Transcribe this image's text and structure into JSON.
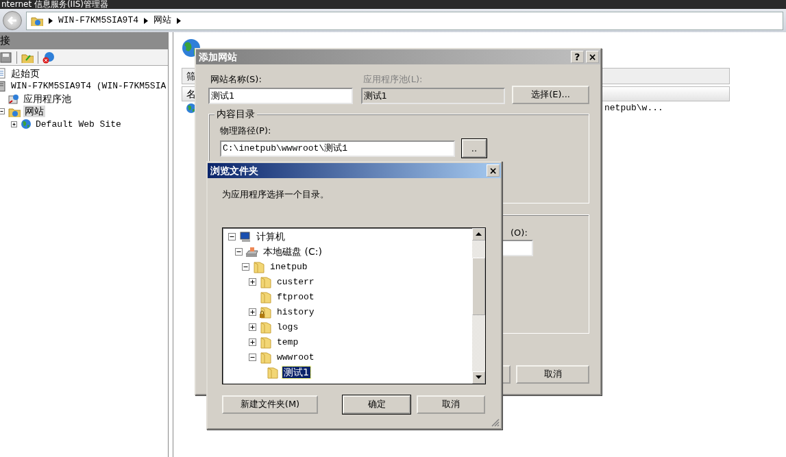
{
  "window": {
    "title": "nternet 信息服务(IIS)管理器"
  },
  "address_bar": {
    "crumbs": [
      "WIN-F7KM5SIA9T4",
      "网站"
    ]
  },
  "connections": {
    "title": "接",
    "tree": [
      {
        "label": "起始页",
        "kind": "page",
        "selected": false
      },
      {
        "label": "WIN-F7KM5SIA9T4 (WIN-F7KM5SIA",
        "kind": "server",
        "selected": false,
        "children": [
          {
            "label": "应用程序池",
            "kind": "pool",
            "selected": false
          },
          {
            "label": "网站",
            "kind": "sites",
            "selected": true,
            "expanded": true,
            "children": [
              {
                "label": "Default Web Site",
                "kind": "globe",
                "selected": false,
                "expanded": false
              }
            ]
          }
        ]
      }
    ]
  },
  "content": {
    "filter_label": "筛",
    "column_1": "名",
    "row_text": "netpub\\w..."
  },
  "add_site_dialog": {
    "title": "添加网站",
    "help_button": "?",
    "close_button": "×",
    "site_name": {
      "label": "网站名称(S):",
      "value": "测试1",
      "disabled": false
    },
    "app_pool": {
      "label": "应用程序池(L):",
      "value": "测试1",
      "disabled": true
    },
    "select_button": "选择(E)...",
    "content_dir_legend": "内容目录",
    "physical_path_label": "物理路径(P):",
    "physical_path": "C:\\inetpub\\wwwroot\\测试1",
    "browse_button": "..",
    "port_label": "(O):",
    "cancel_button": "取消"
  },
  "browse_dialog": {
    "title": "浏览文件夹",
    "close_button": "×",
    "prompt": "为应用程序选择一个目录。",
    "tree": [
      {
        "label": "计算机",
        "kind": "computer",
        "selected": false,
        "expanded": true,
        "children": [
          {
            "label": "本地磁盘 (C:)",
            "kind": "drive",
            "selected": false,
            "expanded": true,
            "children": [
              {
                "label": "inetpub",
                "kind": "folder",
                "locked": false,
                "selected": false,
                "expanded": true,
                "children": [
                  {
                    "label": "custerr",
                    "kind": "folder",
                    "locked": false,
                    "selected": false,
                    "expanded": false
                  },
                  {
                    "label": "ftproot",
                    "kind": "folder",
                    "locked": false,
                    "selected": false
                  },
                  {
                    "label": "history",
                    "kind": "folder",
                    "locked": true,
                    "selected": false,
                    "expanded": false
                  },
                  {
                    "label": "logs",
                    "kind": "folder",
                    "locked": false,
                    "selected": false,
                    "expanded": false
                  },
                  {
                    "label": "temp",
                    "kind": "folder",
                    "locked": false,
                    "selected": false,
                    "expanded": false
                  },
                  {
                    "label": "wwwroot",
                    "kind": "folder",
                    "locked": false,
                    "selected": false,
                    "expanded": true,
                    "children": [
                      {
                        "label": "测试1",
                        "kind": "folder",
                        "locked": false,
                        "selected": true
                      }
                    ]
                  }
                ]
              }
            ]
          }
        ]
      }
    ],
    "buttons": [
      {
        "label": "新建文件夹(M)",
        "default": false
      },
      {
        "label": "确定",
        "default": true
      },
      {
        "label": "取消",
        "default": false
      }
    ]
  }
}
